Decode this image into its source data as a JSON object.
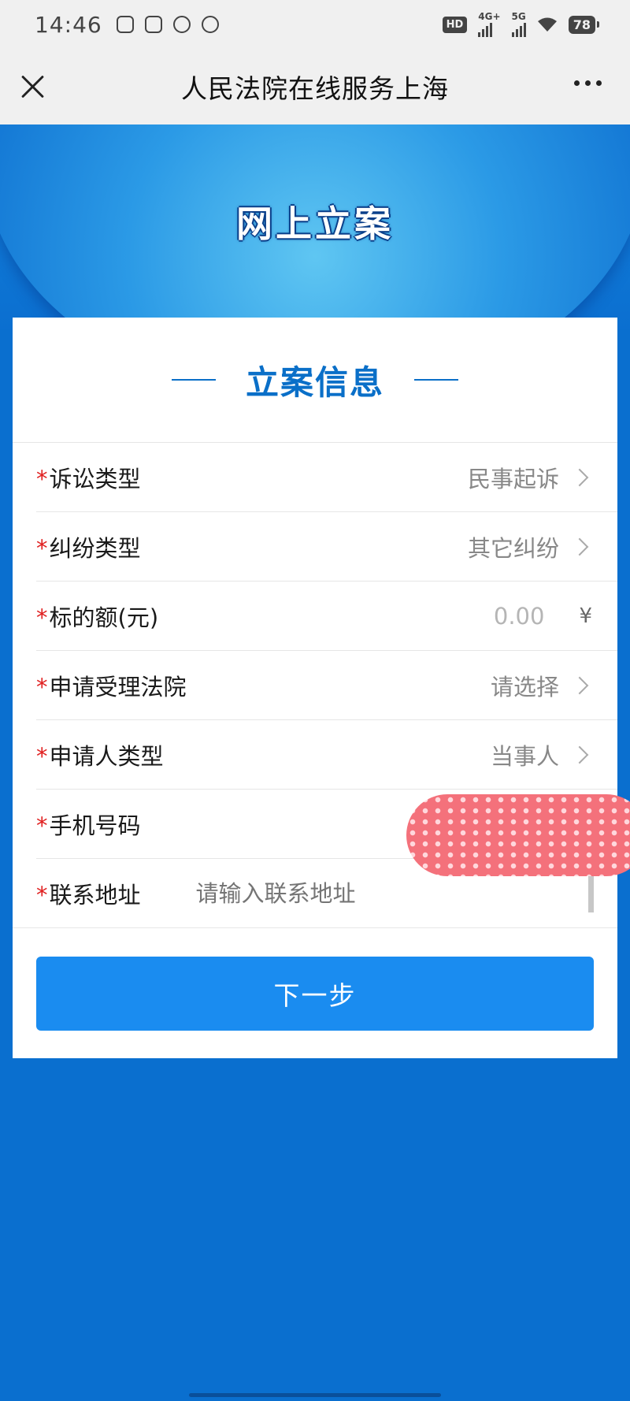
{
  "status_bar": {
    "time": "14:46",
    "network_badge": "HD",
    "signal_1_label": "4G+",
    "signal_2_label": "5G",
    "battery": "78",
    "app_icons": [
      "tv-app-icon",
      "photo-app-icon",
      "tiktok-icon",
      "wechat-icon"
    ]
  },
  "title_bar": {
    "title": "人民法院在线服务上海"
  },
  "banner": {
    "title": "网上立案"
  },
  "form": {
    "section_title": "立案信息",
    "required_mark": "*",
    "rows": [
      {
        "label": "诉讼类型",
        "value": "民事起诉"
      },
      {
        "label": "纠纷类型",
        "value": "其它纠纷"
      },
      {
        "label": "标的额(元)",
        "value": "0.00",
        "suffix": "¥"
      },
      {
        "label": "申请受理法院",
        "value": "请选择"
      },
      {
        "label": "申请人类型",
        "value": "当事人"
      },
      {
        "label": "手机号码",
        "value": ""
      },
      {
        "label": "联系地址",
        "placeholder": "请输入联系地址"
      }
    ],
    "next_button": "下一步"
  },
  "colors": {
    "accent": "#0a6fc8",
    "button": "#1a8cf0",
    "required": "#e02020",
    "background": "#0a6fcf"
  }
}
